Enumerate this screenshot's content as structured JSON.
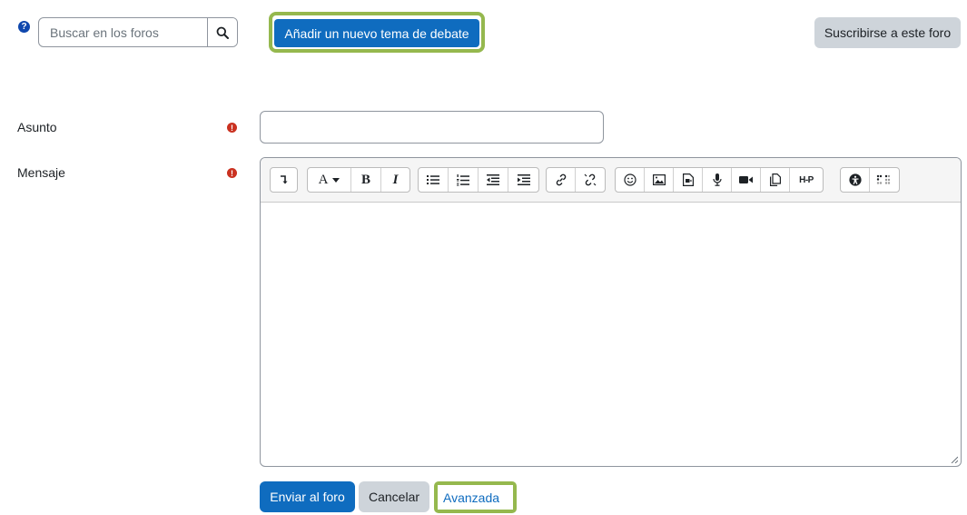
{
  "header": {
    "help_icon_glyph": "?",
    "search": {
      "placeholder": "Buscar en los foros"
    },
    "add_topic_label": "Añadir un nuevo tema de debate",
    "subscribe_label": "Suscribirse a este foro"
  },
  "form": {
    "subject_label": "Asunto",
    "message_label": "Mensaje",
    "required_glyph": "!",
    "subject_value": "",
    "toolbar_buttons": [
      "show-more-buttons-icon",
      "font-color-icon",
      "bold-icon",
      "italic-icon",
      "unordered-list-icon",
      "ordered-list-icon",
      "outdent-icon",
      "indent-icon",
      "link-icon",
      "unlink-icon",
      "emoji-icon",
      "image-icon",
      "media-icon",
      "record-audio-icon",
      "record-video-icon",
      "manage-files-icon",
      "h5p-icon",
      "accessibility-checker-icon",
      "screenreader-helper-icon"
    ],
    "toolbar_text": {
      "bold": "B",
      "italic": "I",
      "font": "A",
      "h5p": "H-P"
    }
  },
  "actions": {
    "submit_label": "Enviar al foro",
    "cancel_label": "Cancelar",
    "advanced_label": "Avanzada"
  },
  "colors": {
    "primary": "#0f6cbf",
    "highlight": "#95b84e",
    "required": "#ca3120",
    "secondary_button": "#ced4da"
  }
}
